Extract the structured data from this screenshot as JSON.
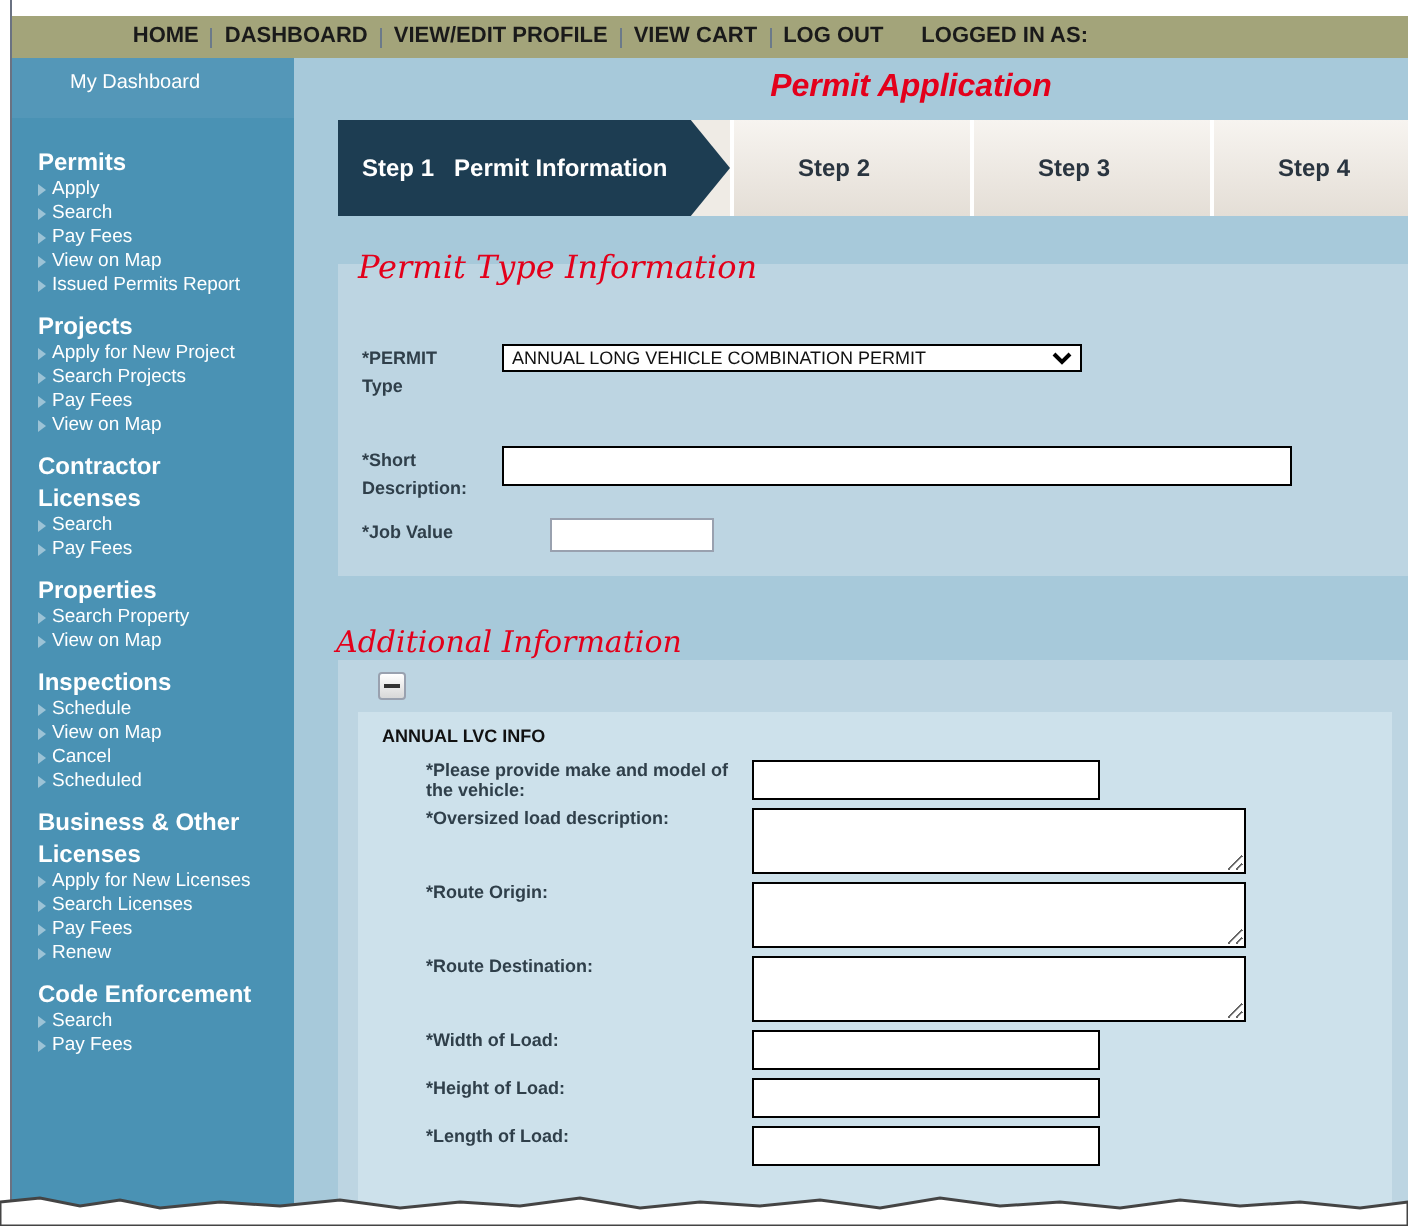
{
  "top_nav": {
    "links": [
      "HOME",
      "DASHBOARD",
      "VIEW/EDIT PROFILE",
      "VIEW CART",
      "LOG OUT"
    ],
    "logged_in_label": "LOGGED IN AS:"
  },
  "sidebar": {
    "header": "My Dashboard",
    "sections": [
      {
        "title": "Permits",
        "items": [
          "Apply",
          "Search",
          "Pay Fees",
          "View on Map",
          "Issued Permits Report"
        ]
      },
      {
        "title": "Projects",
        "items": [
          "Apply for New Project",
          "Search Projects",
          "Pay Fees",
          "View on Map"
        ]
      },
      {
        "title": "Contractor Licenses",
        "items": [
          "Search",
          "Pay Fees"
        ]
      },
      {
        "title": "Properties",
        "items": [
          "Search Property",
          "View on Map"
        ]
      },
      {
        "title": "Inspections",
        "items": [
          "Schedule",
          "View on Map",
          "Cancel",
          "Scheduled"
        ]
      },
      {
        "title": "Business & Other Licenses",
        "items": [
          "Apply for New Licenses",
          "Search Licenses",
          "Pay Fees",
          "Renew"
        ]
      },
      {
        "title": "Code Enforcement",
        "items": [
          "Search",
          "Pay Fees"
        ]
      }
    ]
  },
  "page_title": "Permit Application",
  "steps": [
    {
      "label": "Step 1",
      "title": "Permit Information",
      "selected": true
    },
    {
      "label": "Step 2",
      "selected": false
    },
    {
      "label": "Step 3",
      "selected": false
    },
    {
      "label": "Step 4",
      "selected": false
    }
  ],
  "permit_type_section": {
    "title": "Permit Type Information",
    "fields": [
      {
        "kind": "select",
        "label": "*PERMIT Type",
        "value": "ANNUAL LONG VEHICLE COMBINATION PERMIT"
      },
      {
        "kind": "wide",
        "label": "*Short Description:"
      },
      {
        "kind": "short",
        "label": "*Job Value"
      }
    ]
  },
  "additional_section": {
    "title": "Additional Information",
    "expanded": true,
    "group_title": "ANNUAL LVC INFO",
    "fields": [
      {
        "kind": "input",
        "label": "*Please provide make and model of the vehicle:"
      },
      {
        "kind": "textarea",
        "label": "*Oversized load description:"
      },
      {
        "kind": "textarea",
        "label": "*Route Origin:"
      },
      {
        "kind": "textarea",
        "label": "*Route Destination:"
      },
      {
        "kind": "input",
        "label": "*Width of Load:"
      },
      {
        "kind": "input",
        "label": "*Height of Load:"
      },
      {
        "kind": "input",
        "label": "*Length of Load:"
      }
    ]
  }
}
